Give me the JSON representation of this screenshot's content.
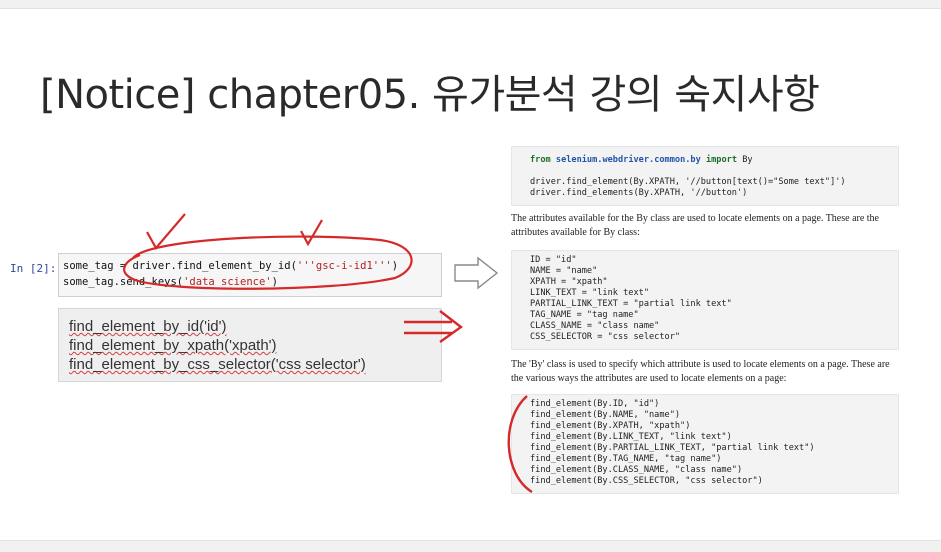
{
  "slide": {
    "title": "[Notice] chapter05. 유가분석 강의 숙지사항"
  },
  "notebook_cell": {
    "prompt": "In [2]:",
    "line1_prefix": "some_tag = driver.find_element_by_id(",
    "line1_string": "'''gsc-i-id1'''",
    "line1_suffix": ")",
    "line2_prefix": "some_tag.send_keys(",
    "line2_string": "'data science'",
    "line2_suffix": ")"
  },
  "methods_box": {
    "items": [
      "find_element_by_id('id')",
      "find_element_by_xpath('xpath')",
      "find_element_by_css_selector('css selector')"
    ]
  },
  "doc": {
    "import_from": "from",
    "import_module": "selenium.webdriver.common.by",
    "import_kw": "import",
    "import_name": "By",
    "xpath_lines": [
      "driver.find_element(By.XPATH, '//button[text()=\"Some text\"]')",
      "driver.find_elements(By.XPATH, '//button')"
    ],
    "para1": "The attributes available for the By class are used to locate elements on a page. These are the attributes available for By class:",
    "attributes": [
      "ID = \"id\"",
      "NAME = \"name\"",
      "XPATH = \"xpath\"",
      "LINK_TEXT = \"link text\"",
      "PARTIAL_LINK_TEXT = \"partial link text\"",
      "TAG_NAME = \"tag name\"",
      "CLASS_NAME = \"class name\"",
      "CSS_SELECTOR = \"css selector\""
    ],
    "para2": "The 'By' class is used to specify which attribute is used to locate elements on a page. These are the various ways the attributes are used to locate elements on a page:",
    "find_calls": [
      "find_element(By.ID, \"id\")",
      "find_element(By.NAME, \"name\")",
      "find_element(By.XPATH, \"xpath\")",
      "find_element(By.LINK_TEXT, \"link text\")",
      "find_element(By.PARTIAL_LINK_TEXT, \"partial link text\")",
      "find_element(By.TAG_NAME, \"tag name\")",
      "find_element(By.CLASS_NAME, \"class name\")",
      "find_element(By.CSS_SELECTOR, \"css selector\")"
    ]
  },
  "annotation_color": "#d42a2a"
}
